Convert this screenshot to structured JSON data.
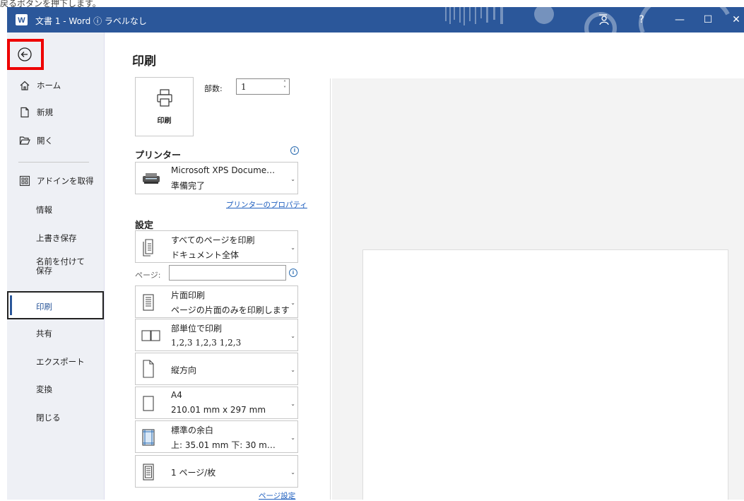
{
  "caption_text": "戻るボタンを押下します。",
  "titlebar": {
    "title": "文書 1 - Word ⓘ ラベルなし",
    "buttons": {
      "help": "?",
      "minimize": "—",
      "maximize": "☐",
      "close": "✕"
    },
    "accent": "#2b579a"
  },
  "sidebar": {
    "items": [
      {
        "label": "ホーム",
        "icon": "home-icon"
      },
      {
        "label": "新規",
        "icon": "new-document-icon"
      },
      {
        "label": "開く",
        "icon": "folder-open-icon"
      },
      {
        "label": "アドインを取得",
        "icon": "add-ins-icon"
      },
      {
        "label": "情報"
      },
      {
        "label": "上書き保存"
      },
      {
        "label": "名前を付けて保存"
      },
      {
        "label": "印刷"
      },
      {
        "label": "共有"
      },
      {
        "label": "エクスポート"
      },
      {
        "label": "変換"
      },
      {
        "label": "閉じる"
      }
    ],
    "selected": "印刷"
  },
  "print": {
    "title": "印刷",
    "print_button": "印刷",
    "copies_label": "部数:",
    "copies_value": "1"
  },
  "printer": {
    "heading": "プリンター",
    "name": "Microsoft XPS Docume…",
    "status": "準備完了",
    "properties_link": "プリンターのプロパティ"
  },
  "settings": {
    "heading": "設定",
    "pages_label": "ページ:",
    "pages_value": "",
    "options": [
      {
        "line1": "すべてのページを印刷",
        "line2": "ドキュメント全体"
      },
      {
        "line1": "片面印刷",
        "line2": "ページの片面のみを印刷します"
      },
      {
        "line1": "部単位で印刷",
        "line2": "1,2,3    1,2,3    1,2,3"
      },
      {
        "line1": "縦方向",
        "line2": ""
      },
      {
        "line1": "A4",
        "line2": "210.01 mm x 297 mm"
      },
      {
        "line1": "標準の余白",
        "line2": "上: 35.01 mm 下: 30 m…"
      },
      {
        "line1": "1 ページ/枚",
        "line2": ""
      }
    ],
    "page_setup_link": "ページ設定"
  }
}
